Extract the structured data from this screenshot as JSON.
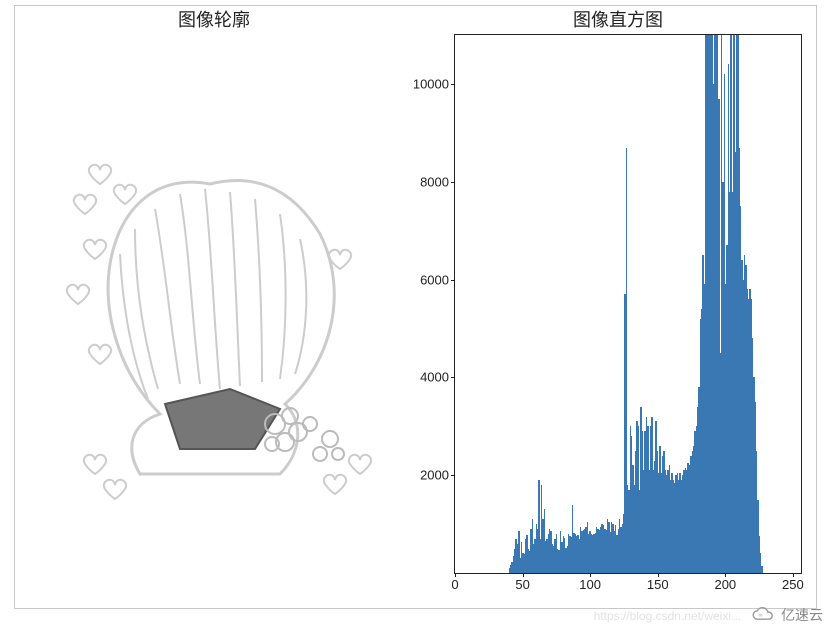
{
  "left": {
    "title": "图像轮廓"
  },
  "right": {
    "title": "图像直方图"
  },
  "watermark": "https://blog.csdn.net/weixi...",
  "logo_text": "亿速云",
  "chart_data": [
    {
      "type": "image",
      "title": "图像轮廓",
      "description": "Grayscale contour / edge-detection image of an anime-style figure with hair and heart shapes, on white background"
    },
    {
      "type": "bar",
      "title": "图像直方图",
      "xlabel": "",
      "ylabel": "",
      "xlim": [
        0,
        256
      ],
      "ylim": [
        0,
        11000
      ],
      "xticks": [
        0,
        50,
        100,
        150,
        200,
        250
      ],
      "yticks": [
        2000,
        4000,
        6000,
        8000,
        10000
      ],
      "x": [
        0,
        1,
        2,
        3,
        4,
        5,
        6,
        7,
        8,
        9,
        10,
        11,
        12,
        13,
        14,
        15,
        16,
        17,
        18,
        19,
        20,
        21,
        22,
        23,
        24,
        25,
        26,
        27,
        28,
        29,
        30,
        31,
        32,
        33,
        34,
        35,
        36,
        37,
        38,
        39,
        40,
        41,
        42,
        43,
        44,
        45,
        46,
        47,
        48,
        49,
        50,
        51,
        52,
        53,
        54,
        55,
        56,
        57,
        58,
        59,
        60,
        61,
        62,
        63,
        64,
        65,
        66,
        67,
        68,
        69,
        70,
        71,
        72,
        73,
        74,
        75,
        76,
        77,
        78,
        79,
        80,
        81,
        82,
        83,
        84,
        85,
        86,
        87,
        88,
        89,
        90,
        91,
        92,
        93,
        94,
        95,
        96,
        97,
        98,
        99,
        100,
        101,
        102,
        103,
        104,
        105,
        106,
        107,
        108,
        109,
        110,
        111,
        112,
        113,
        114,
        115,
        116,
        117,
        118,
        119,
        120,
        121,
        122,
        123,
        124,
        125,
        126,
        127,
        128,
        129,
        130,
        131,
        132,
        133,
        134,
        135,
        136,
        137,
        138,
        139,
        140,
        141,
        142,
        143,
        144,
        145,
        146,
        147,
        148,
        149,
        150,
        151,
        152,
        153,
        154,
        155,
        156,
        157,
        158,
        159,
        160,
        161,
        162,
        163,
        164,
        165,
        166,
        167,
        168,
        169,
        170,
        171,
        172,
        173,
        174,
        175,
        176,
        177,
        178,
        179,
        180,
        181,
        182,
        183,
        184,
        185,
        186,
        187,
        188,
        189,
        190,
        191,
        192,
        193,
        194,
        195,
        196,
        197,
        198,
        199,
        200,
        201,
        202,
        203,
        204,
        205,
        206,
        207,
        208,
        209,
        210,
        211,
        212,
        213,
        214,
        215,
        216,
        217,
        218,
        219,
        220,
        221,
        222,
        223,
        224,
        225,
        226,
        227,
        228,
        229,
        230,
        231,
        232,
        233,
        234,
        235,
        236,
        237,
        238,
        239,
        240,
        241,
        242,
        243,
        244,
        245,
        246,
        247,
        248,
        249,
        250,
        251,
        252,
        253,
        254,
        255
      ],
      "values": [
        0,
        0,
        0,
        0,
        0,
        0,
        0,
        0,
        0,
        0,
        0,
        0,
        0,
        0,
        0,
        0,
        0,
        0,
        0,
        0,
        0,
        0,
        0,
        0,
        0,
        0,
        0,
        0,
        0,
        0,
        0,
        0,
        0,
        0,
        0,
        0,
        0,
        0,
        0,
        0,
        100,
        160,
        220,
        350,
        500,
        700,
        600,
        850,
        300,
        640,
        400,
        380,
        700,
        780,
        500,
        450,
        900,
        1100,
        600,
        700,
        1000,
        900,
        1900,
        700,
        1800,
        1100,
        1300,
        650,
        700,
        800,
        900,
        850,
        600,
        550,
        700,
        800,
        500,
        480,
        850,
        640,
        750,
        720,
        520,
        560,
        800,
        750,
        740,
        1400,
        820,
        800,
        760,
        780,
        700,
        950,
        850,
        880,
        900,
        940,
        1050,
        800,
        850,
        800,
        780,
        800,
        820,
        950,
        900,
        880,
        950,
        1000,
        980,
        900,
        880,
        1100,
        1050,
        830,
        1050,
        1000,
        850,
        980,
        780,
        900,
        1100,
        950,
        1000,
        1200,
        5700,
        8700,
        1800,
        1700,
        3000,
        2800,
        2200,
        1800,
        2500,
        3100,
        3000,
        1700,
        3400,
        2900,
        2100,
        2900,
        3200,
        3000,
        2100,
        3000,
        3200,
        2100,
        2300,
        3100,
        2500,
        2050,
        2600,
        2050,
        2400,
        2500,
        2100,
        2000,
        2100,
        2200,
        1900,
        2050,
        1900,
        1850,
        2000,
        2050,
        1900,
        2050,
        1900,
        2000,
        2100,
        2150,
        2100,
        2250,
        2200,
        2400,
        2500,
        2600,
        2900,
        3000,
        3400,
        3800,
        5200,
        5400,
        6500,
        5900,
        11000,
        11000,
        11000,
        11000,
        11000,
        11000,
        10000,
        11000,
        11000,
        11000,
        9700,
        4500,
        11000,
        8000,
        10200,
        5900,
        6700,
        10400,
        7800,
        11000,
        7800,
        11000,
        8600,
        11000,
        11000,
        8700,
        7500,
        6400,
        6000,
        6500,
        6300,
        5800,
        5600,
        5800,
        5600,
        4800,
        4000,
        3500,
        2500,
        1500,
        750,
        400,
        150,
        0,
        0,
        0,
        0,
        0,
        0,
        0,
        0,
        0,
        0,
        0,
        0,
        0,
        0,
        0,
        0,
        0,
        0,
        0,
        0,
        0,
        0,
        0,
        0,
        0,
        0,
        0,
        0
      ]
    }
  ]
}
